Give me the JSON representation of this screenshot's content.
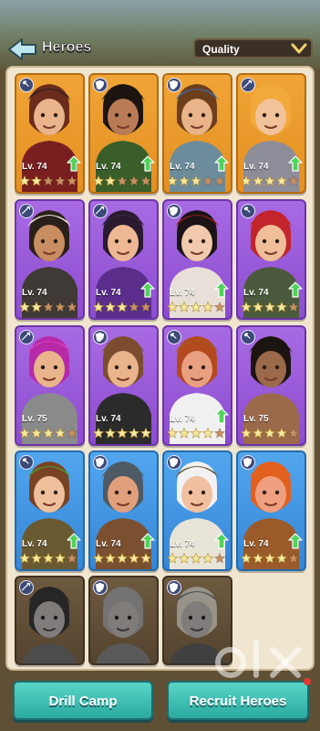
{
  "header": {
    "title": "Heroes",
    "sort_label": "Quality"
  },
  "heroes": [
    {
      "level": "Lv. 74",
      "rarity": "epic",
      "role": "axe",
      "stars": 2,
      "max_stars": 5,
      "upgrade": true,
      "skin": "#e9b48c",
      "hair": "#6b2c1c",
      "hat": "#2a2020",
      "outfit": "#7a1f1f"
    },
    {
      "level": "Lv. 74",
      "rarity": "epic",
      "role": "shield",
      "stars": 2,
      "max_stars": 5,
      "upgrade": true,
      "skin": "#b97b55",
      "hair": "#1c1410",
      "hat": "#1c1410",
      "outfit": "#3a5e2a"
    },
    {
      "level": "Lv. 74",
      "rarity": "epic",
      "role": "shield",
      "stars": 3,
      "max_stars": 5,
      "upgrade": true,
      "skin": "#eab48a",
      "hair": "#6d3e1c",
      "hat": "#3e6aa8",
      "outfit": "#6c8c9c"
    },
    {
      "level": "Lv. 74",
      "rarity": "epic",
      "role": "mage",
      "stars": 4,
      "max_stars": 5,
      "upgrade": true,
      "skin": "#f2c29b",
      "hair": "#f2a93b",
      "hat": "#f2a93b",
      "outfit": "#8d8d9a"
    },
    {
      "level": "Lv. 74",
      "rarity": "purple",
      "role": "mage",
      "stars": 2,
      "max_stars": 5,
      "upgrade": false,
      "skin": "#c98d62",
      "hair": "#2a201a",
      "hat": "#eae6da",
      "outfit": "#3f3a35"
    },
    {
      "level": "Lv. 74",
      "rarity": "purple",
      "role": "mage",
      "stars": 3,
      "max_stars": 5,
      "upgrade": true,
      "skin": "#eeb894",
      "hair": "#2a1a30",
      "hat": "#332846",
      "outfit": "#5a2e8a"
    },
    {
      "level": "Lv. 74",
      "rarity": "purple",
      "role": "shield",
      "stars": 4,
      "max_stars": 5,
      "upgrade": true,
      "skin": "#f1c9ac",
      "hair": "#1a1416",
      "hat": "#8f1a1a",
      "outfit": "#e8e0d8"
    },
    {
      "level": "Lv. 74",
      "rarity": "purple",
      "role": "axe",
      "stars": 4,
      "max_stars": 5,
      "upgrade": true,
      "skin": "#f0be98",
      "hair": "#c2252b",
      "hat": "#c2252b",
      "outfit": "#4b5a3c"
    },
    {
      "level": "Lv. 75",
      "rarity": "purple",
      "role": "mage",
      "stars": 4,
      "max_stars": 5,
      "upgrade": false,
      "skin": "#e9b48c",
      "hair": "#b62aa8",
      "hat": "#d93ec0",
      "outfit": "#8a8a8a"
    },
    {
      "level": "Lv. 74",
      "rarity": "purple",
      "role": "shield",
      "stars": 5,
      "max_stars": 5,
      "upgrade": false,
      "skin": "#e9b48c",
      "hair": "#7b4c2e",
      "hat": "#7b4c2e",
      "outfit": "#2b2b2b"
    },
    {
      "level": "Lv. 74",
      "rarity": "purple",
      "role": "axe",
      "stars": 4,
      "max_stars": 5,
      "upgrade": true,
      "skin": "#e9a080",
      "hair": "#b24a1e",
      "hat": "#a35a22",
      "outfit": "#f0f0f0"
    },
    {
      "level": "Lv. 75",
      "rarity": "purple",
      "role": "axe",
      "stars": 4,
      "max_stars": 5,
      "upgrade": false,
      "skin": "#9b6a4a",
      "hair": "#1c1410",
      "hat": "#1c1410",
      "outfit": "#9b6a4a"
    },
    {
      "level": "Lv. 74",
      "rarity": "blue",
      "role": "axe",
      "stars": 4,
      "max_stars": 5,
      "upgrade": true,
      "skin": "#eec09c",
      "hair": "#7a4224",
      "hat": "#4a9a2a",
      "outfit": "#6a5a32"
    },
    {
      "level": "Lv. 74",
      "rarity": "blue",
      "role": "shield",
      "stars": 5,
      "max_stars": 5,
      "upgrade": true,
      "skin": "#e0a07c",
      "hair": "#505a64",
      "hat": "#505a64",
      "outfit": "#7a5030"
    },
    {
      "level": "Lv. 74",
      "rarity": "blue",
      "role": "shield",
      "stars": 4,
      "max_stars": 5,
      "upgrade": true,
      "skin": "#f0c0a0",
      "hair": "#f2f2f2",
      "hat": "#6a5a3a",
      "outfit": "#e8e4d8"
    },
    {
      "level": "Lv. 74",
      "rarity": "blue",
      "role": "shield",
      "stars": 4,
      "max_stars": 5,
      "upgrade": true,
      "skin": "#f0a080",
      "hair": "#e2601e",
      "hat": "#e2601e",
      "outfit": "#9a5a2a"
    },
    {
      "level": "",
      "rarity": "locked",
      "role": "mage",
      "stars": 0,
      "max_stars": 0,
      "upgrade": false,
      "skin": "#c9a080",
      "hair": "#333",
      "hat": "#333",
      "outfit": "#666"
    },
    {
      "level": "",
      "rarity": "locked",
      "role": "shield",
      "stars": 0,
      "max_stars": 0,
      "upgrade": false,
      "skin": "#c9a080",
      "hair": "#999",
      "hat": "#999",
      "outfit": "#777"
    },
    {
      "level": "",
      "rarity": "locked",
      "role": "shield",
      "stars": 0,
      "max_stars": 0,
      "upgrade": false,
      "skin": "#c9a080",
      "hair": "#f2c440",
      "hat": "#4a6aa0",
      "outfit": "#555"
    }
  ],
  "buttons": {
    "drill_camp": "Drill Camp",
    "recruit_heroes": "Recruit Heroes"
  },
  "colors": {
    "accent_teal": "#2ba9a1",
    "epic": "#e48f22",
    "purple": "#8c4ccf",
    "blue": "#3586d6",
    "star_filled": "#f5e9a0",
    "star_empty": "#c89060"
  },
  "watermark": {
    "text": "olx"
  }
}
